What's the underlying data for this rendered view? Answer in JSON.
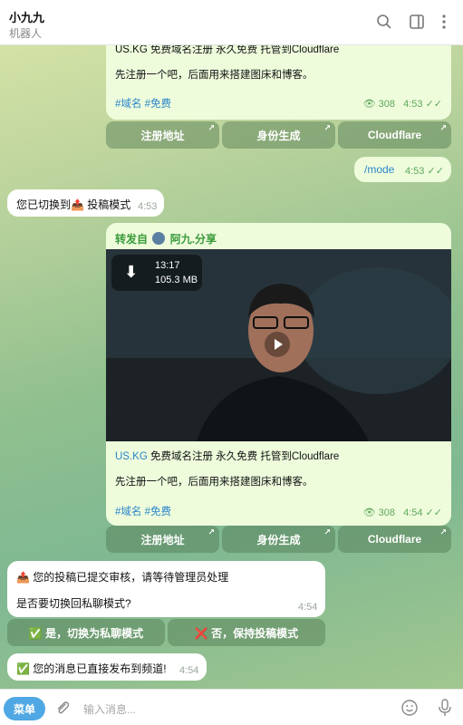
{
  "header": {
    "title": "小九九",
    "subtitle": "机器人",
    "icons": [
      "search-icon",
      "sidebar-icon",
      "more-vertical-icon"
    ]
  },
  "msg_top": {
    "line1": "US.KG 免费域名注册 永久免费 托管到Cloudflare",
    "line2": "先注册一个吧，后面用来搭建图床和博客。",
    "tags": "#域名 #免费",
    "views": "308",
    "time": "4:53"
  },
  "buttons_top": [
    "注册地址",
    "身份生成",
    "Cloudflare"
  ],
  "msg_mode": {
    "text": "/mode",
    "time": "4:53"
  },
  "msg_switched": {
    "text": "您已切换到📤 投稿模式",
    "time": "4:53"
  },
  "msg_forward": {
    "forward_label": "转发自",
    "channel": "阿九.分享",
    "video_duration": "13:17",
    "video_size": "105.3 MB",
    "link": "US.KG",
    "line1_rest": " 免费域名注册 永久免费 托管到Cloudflare",
    "line2": "先注册一个吧，后面用来搭建图床和博客。",
    "tags": "#域名 #免费",
    "views": "308",
    "time": "4:54"
  },
  "buttons_forward": [
    "注册地址",
    "身份生成",
    "Cloudflare"
  ],
  "msg_submitted": {
    "line1": "📤 您的投稿已提交审核，请等待管理员处理",
    "line2": "是否要切换回私聊模式?",
    "time": "4:54"
  },
  "buttons_choice": [
    "✅ 是，切换为私聊模式",
    "❌ 否，保持投稿模式"
  ],
  "msg_published": {
    "text": "✅ 您的消息已直接发布到频道!",
    "time": "4:54"
  },
  "input": {
    "menu_label": "菜单",
    "placeholder": "输入消息..."
  },
  "colors": {
    "accent": "#4fa7e3",
    "tag": "#2a85c9",
    "forward": "#3a9a3a"
  }
}
